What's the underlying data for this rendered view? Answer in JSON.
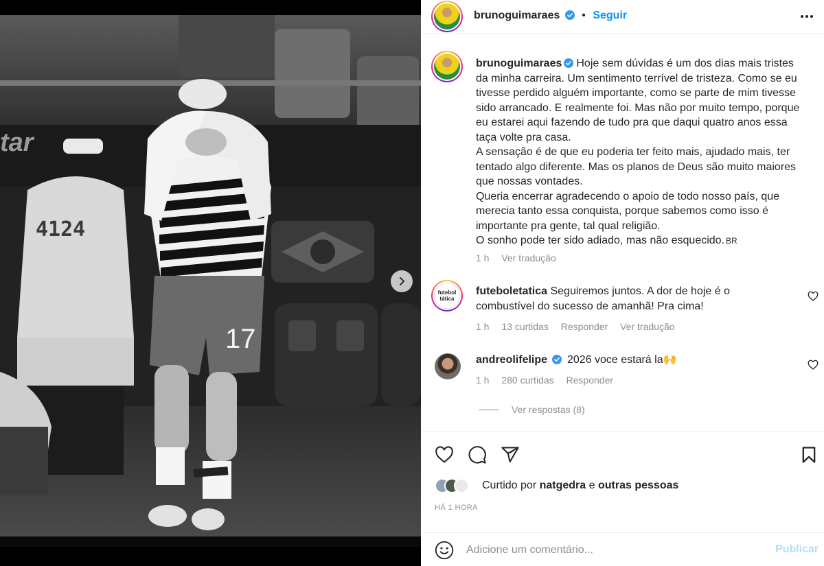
{
  "post": {
    "author": "brunoguimaraes",
    "follow_label": "Seguir",
    "dot": "•"
  },
  "caption": {
    "username": "brunoguimaraes",
    "text": "Hoje sem dúvidas é um dos dias mais tristes da minha carreira. Um sentimento terrível de tristeza. Como se eu tivesse perdido alguém importante, como se parte de mim tivesse sido arrancado. E realmente foi. Mas não por muito tempo, porque eu estarei aqui fazendo de tudo pra que daqui quatro anos essa taça volte pra casa.\nA sensação é de que eu poderia ter feito mais, ajudado mais, ter tentado algo diferente. Mas os planos de Deus são muito maiores que nossas vontades.\nQueria encerrar agradecendo o apoio de todo nosso país, que merecia tanto essa conquista, porque sabemos como isso é importante pra gente, tal qual religião.\nO sonho pode ter sido adiado, mas não esquecido.",
    "flag_text": "BR",
    "time": "1 h",
    "translate": "Ver tradução"
  },
  "comments": [
    {
      "username": "futeboletatica",
      "avatar_text": "futebol tática",
      "text": "Seguiremos juntos. A dor de hoje é o combustível do sucesso de amanhã! Pra cima!",
      "time": "1 h",
      "likes": "13 curtidas",
      "reply": "Responder",
      "translate": "Ver tradução"
    },
    {
      "username": "andreolifelipe",
      "text": "2026 voce estará la🙌",
      "time": "1 h",
      "likes": "280 curtidas",
      "reply": "Responder",
      "view_replies": "Ver respostas (8)"
    }
  ],
  "liked_by": {
    "prefix": "Curtido por",
    "user": "natgedra",
    "conj": "e",
    "others": "outras pessoas"
  },
  "timestamp": "HÁ 1 HORA",
  "add_comment": {
    "placeholder": "Adicione um comentário...",
    "publish": "Publicar"
  },
  "photo": {
    "vest_number": "4124",
    "shorts_number": "17",
    "stadium_text": "tar"
  },
  "colors": {
    "accent": "#0095f6",
    "verified": "#3897f0",
    "publish_disabled": "#b2dffc",
    "secondary_text": "#8e8e8e"
  },
  "icons": [
    "verified-icon",
    "more-options-icon",
    "heart-icon",
    "comment-icon",
    "share-icon",
    "bookmark-icon",
    "emoji-icon",
    "chevron-right-icon"
  ]
}
